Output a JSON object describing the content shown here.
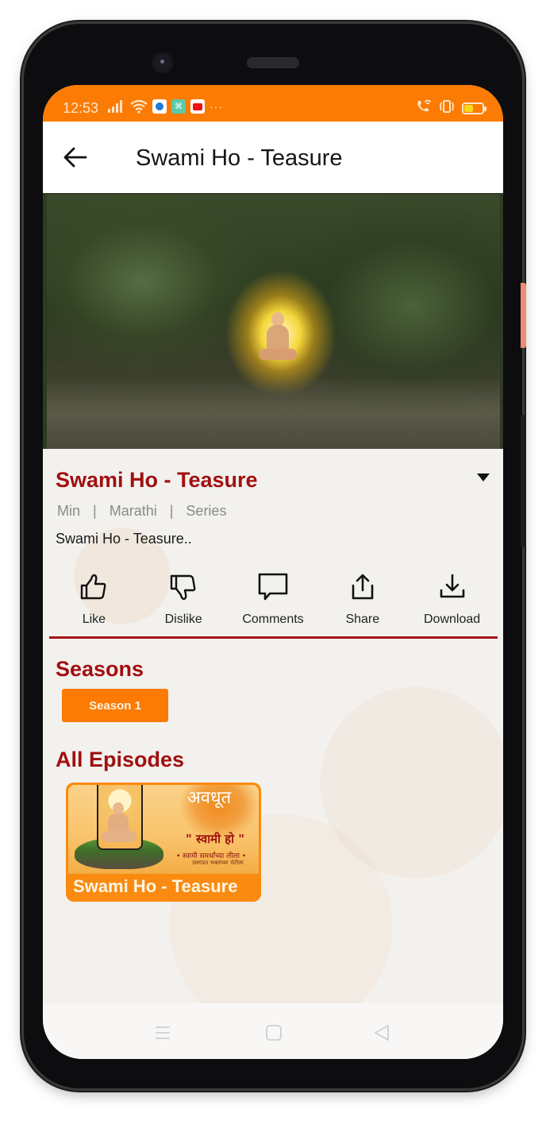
{
  "status_bar": {
    "time": "12:53",
    "icons": [
      "signal-icon",
      "wifi-icon",
      "app-notification-blue-icon",
      "app-notification-teal-icon",
      "youtube-notification-icon",
      "more-notifications-icon"
    ],
    "overflow": "···",
    "right_icons": [
      "wifi-calling-icon",
      "vibrate-icon",
      "battery-icon"
    ],
    "battery_level": 0.45,
    "battery_color": "#f9d71c"
  },
  "app_bar": {
    "title": "Swami Ho - Teasure",
    "back_icon": "arrow-left-icon"
  },
  "details": {
    "title": "Swami Ho - Teasure",
    "meta": [
      "Min",
      "|",
      "Marathi",
      "|",
      "Series"
    ],
    "description": "Swami Ho - Teasure..",
    "expand_icon": "caret-down-icon"
  },
  "actions": [
    {
      "label": "Like",
      "icon": "thumbs-up-icon"
    },
    {
      "label": "Dislike",
      "icon": "thumbs-down-icon"
    },
    {
      "label": "Comments",
      "icon": "comment-icon"
    },
    {
      "label": "Share",
      "icon": "share-icon"
    },
    {
      "label": "Download",
      "icon": "download-icon"
    }
  ],
  "seasons": {
    "heading": "Seasons",
    "items": [
      {
        "label": "Season 1",
        "selected": true
      }
    ]
  },
  "episodes": {
    "heading": "All Episodes",
    "items": [
      {
        "title": "Swami Ho - Teasure",
        "thumb_logo": "अवधूत",
        "thumb_text": "\" स्वामी हो \"",
        "thumb_sub": "• स्वामी समर्थांच्या लीला •",
        "thumb_sub2": "उलगडत भक्तांच्या भेटीला"
      }
    ]
  },
  "nav_bar": {
    "buttons": [
      "recents-icon",
      "home-icon",
      "back-icon"
    ]
  },
  "colors": {
    "brand_orange": "#fb7b05",
    "title_red": "#a01010",
    "divider_red": "#a31515"
  }
}
